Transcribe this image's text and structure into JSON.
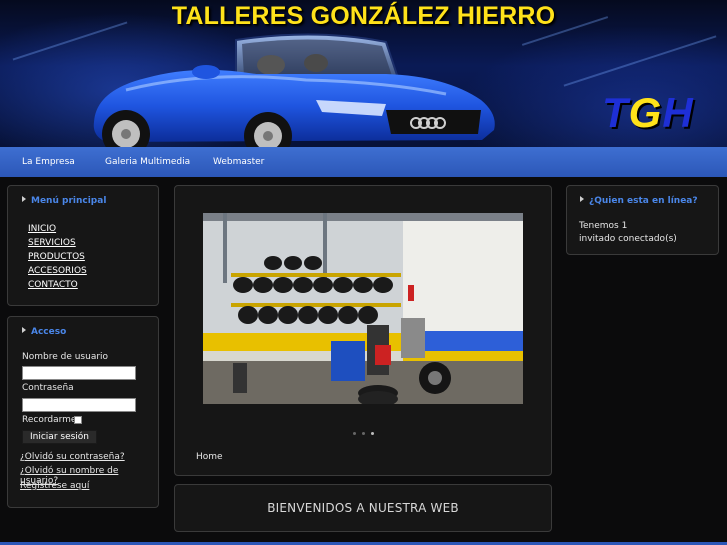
{
  "header": {
    "title": "TALLERES GONZÁLEZ HIERRO",
    "logo_letters": [
      "T",
      "G",
      "H"
    ]
  },
  "nav": {
    "items": [
      "La Empresa",
      "Galeria Multimedia",
      "Webmaster"
    ]
  },
  "menu": {
    "title": "Menú principal",
    "items": [
      "INICIO",
      "SERVICIOS",
      "PRODUCTOS",
      "ACCESORIOS",
      "CONTACTO"
    ]
  },
  "login": {
    "title": "Acceso",
    "username_label": "Nombre de usuario",
    "username_value": "",
    "password_label": "Contraseña",
    "password_value": "",
    "remember_label": "Recordarme",
    "submit_label": "Iniciar sesión",
    "forgot_password": "¿Olvidó su contraseña?",
    "forgot_username": "¿Olvidó su nombre de usuario?",
    "register": "Regístrese aquí"
  },
  "online": {
    "title": "¿Quien esta en línea?",
    "line1": "Tenemos 1",
    "line2": "invitado conectado(s)"
  },
  "slideshow": {
    "active_index": 2,
    "count": 3
  },
  "breadcrumb": "Home",
  "welcome": "BIENVENIDOS A NUESTRA WEB",
  "colors": {
    "accent": "#2c57b8",
    "title_yellow": "#ffe21a",
    "panel_title": "#4a86e8"
  }
}
